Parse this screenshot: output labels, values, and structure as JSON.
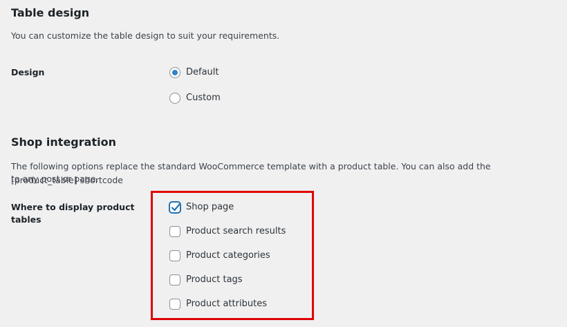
{
  "table_design": {
    "title": "Table design",
    "description": "You can customize the table design to suit your requirements.",
    "design_label": "Design",
    "options": [
      {
        "label": "Default",
        "checked": true
      },
      {
        "label": "Custom",
        "checked": false
      }
    ]
  },
  "shop_integration": {
    "title": "Shop integration",
    "description_line1": "The following options replace the standard WooCommerce template with a product table. You can also add the [product_table] shortcode",
    "description_line2": "to any post or page.",
    "display_label_line1": "Where to display product",
    "display_label_line2": "tables",
    "options": [
      {
        "label": "Shop page",
        "checked": true
      },
      {
        "label": "Product search results",
        "checked": false
      },
      {
        "label": "Product categories",
        "checked": false
      },
      {
        "label": "Product tags",
        "checked": false
      },
      {
        "label": "Product attributes",
        "checked": false
      }
    ]
  },
  "colors": {
    "background": "#f0f0f1",
    "accent": "#2271b1",
    "radio_dot": "#3582c4",
    "highlight": "#e00000"
  }
}
